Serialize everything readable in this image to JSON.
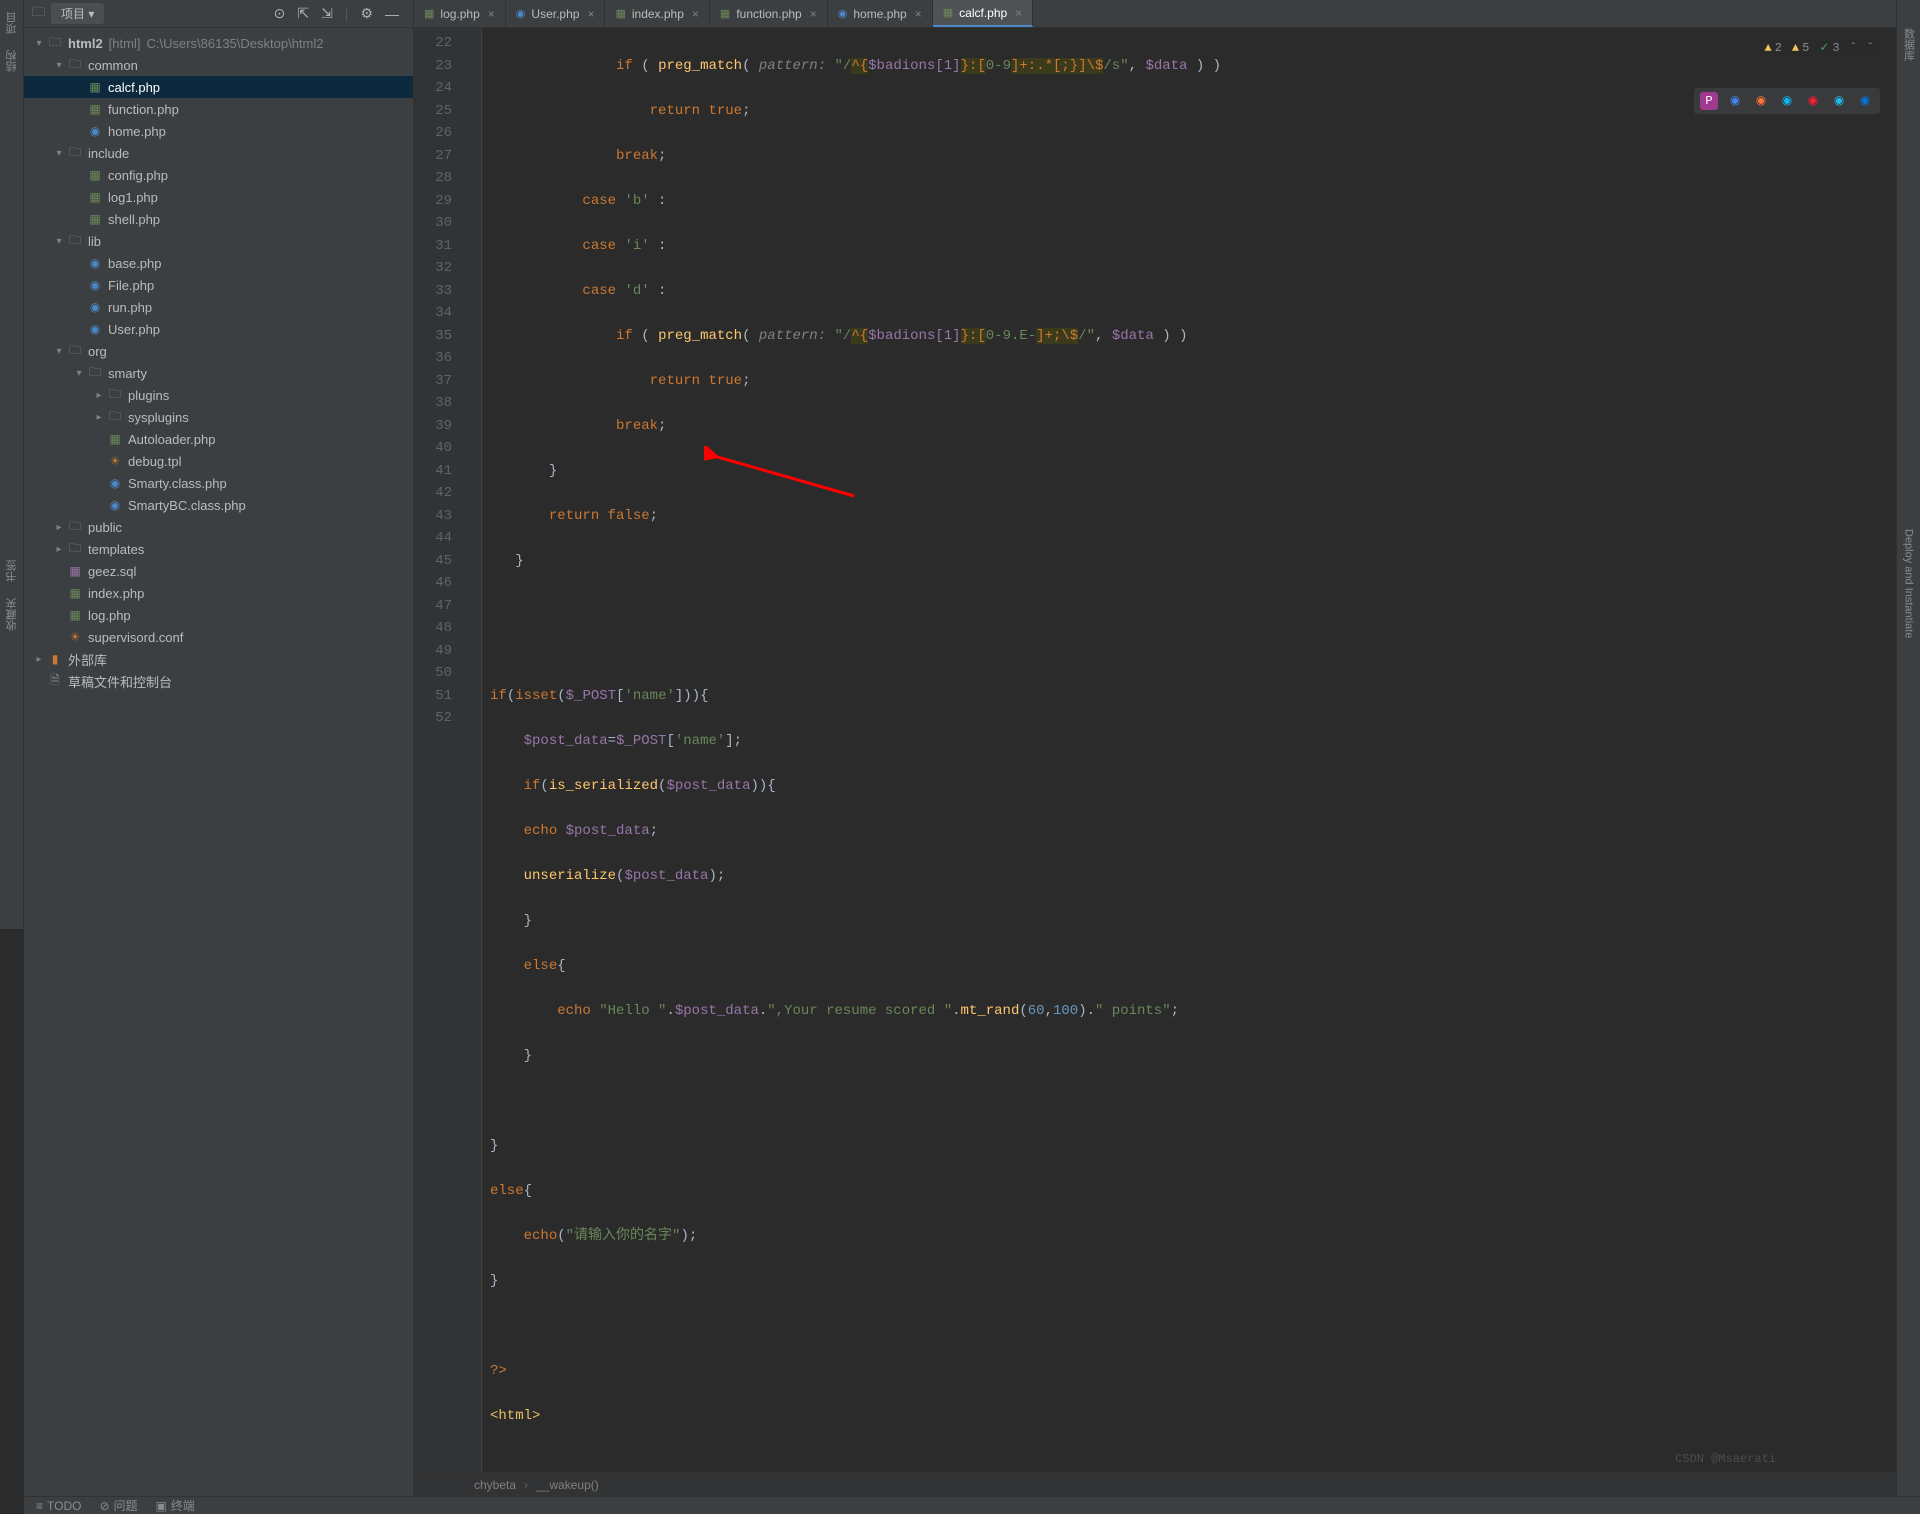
{
  "toolbar": {
    "project_label": "项目"
  },
  "left_strip": {
    "l1": "项目",
    "l2": "结构",
    "l3": "书签",
    "l4": "收藏夹"
  },
  "right_strip": {
    "l1": "数据库",
    "l2": "Deploy and Instantiate"
  },
  "tree": {
    "root": "html2",
    "root_hint_mod": "[html]",
    "root_hint_path": "C:\\Users\\86135\\Desktop\\html2",
    "common": "common",
    "calcf": "calcf.php",
    "function": "function.php",
    "home": "home.php",
    "include": "include",
    "config": "config.php",
    "log1": "log1.php",
    "shell": "shell.php",
    "lib": "lib",
    "base": "base.php",
    "file": "File.php",
    "run": "run.php",
    "user": "User.php",
    "org": "org",
    "smarty": "smarty",
    "plugins": "plugins",
    "sysplugins": "sysplugins",
    "autoloader": "Autoloader.php",
    "debug": "debug.tpl",
    "smartyc": "Smarty.class.php",
    "smartybc": "SmartyBC.class.php",
    "public": "public",
    "templates": "templates",
    "geez": "geez.sql",
    "indexphp": "index.php",
    "logphp": "log.php",
    "supervisord": "supervisord.conf",
    "ext_lib": "外部库",
    "scratch": "草稿文件和控制台"
  },
  "tabs": {
    "t1": "log.php",
    "t2": "User.php",
    "t3": "index.php",
    "t4": "function.php",
    "t5": "home.php",
    "t6": "calcf.php"
  },
  "gutter": {
    "start": 22,
    "end": 52
  },
  "inspections": {
    "warn": "2",
    "weak": "5",
    "typo": "3"
  },
  "breadcrumb": {
    "b1": "chybeta",
    "b2": "__wakeup()"
  },
  "bottom": {
    "todo": "TODO",
    "problems": "问题",
    "terminal": "终端"
  },
  "watermark": "CSDN @Msaerati",
  "code": {
    "l22_a": "if",
    "l22_b": " ( ",
    "l22_c": "preg_match",
    "l22_d": "( ",
    "l22_p": "pattern: ",
    "l22_r1": "\"/",
    "l22_r2": "^{",
    "l22_r3": "$badions[1]",
    "l22_r4": "}",
    "l22_r5": ":[",
    "l22_r6": "0-9",
    "l22_r7": "]+:.*[;}]\\$",
    "l22_r8": "/s\"",
    "l22_e": ", ",
    "l22_v": "$data",
    "l22_f": " ) )",
    "l23_a": "return ",
    "l23_b": "true",
    "l23_c": ";",
    "l24_a": "break",
    "l24_b": ";",
    "l25_a": "case ",
    "l25_b": "'b'",
    "l25_c": " :",
    "l26_a": "case ",
    "l26_b": "'i'",
    "l26_c": " :",
    "l27_a": "case ",
    "l27_b": "'d'",
    "l27_c": " :",
    "l28_a": "if",
    "l28_b": " ( ",
    "l28_c": "preg_match",
    "l28_d": "( ",
    "l28_p": "pattern: ",
    "l28_r1": "\"/",
    "l28_r2": "^{",
    "l28_r3": "$badions[1]",
    "l28_r4": "}",
    "l28_r5": ":[",
    "l28_r6": "0-9.E-",
    "l28_r7": "]+;\\$",
    "l28_r8": "/\"",
    "l28_e": ", ",
    "l28_v": "$data",
    "l28_f": " ) )",
    "l29_a": "return ",
    "l29_b": "true",
    "l29_c": ";",
    "l30_a": "break",
    "l30_b": ";",
    "l31_a": "}",
    "l32_a": "return ",
    "l32_b": "false",
    "l32_c": ";",
    "l33_a": "}",
    "l36_a": "if",
    "l36_b": "(",
    "l36_c": "isset",
    "l36_d": "(",
    "l36_v": "$_POST",
    "l36_e": "[",
    "l36_s": "'name'",
    "l36_f": "])){",
    "l37_v1": "$post_data",
    "l37_a": "=",
    "l37_v2": "$_POST",
    "l37_b": "[",
    "l37_s": "'name'",
    "l37_c": "];",
    "l38_a": "if",
    "l38_b": "(",
    "l38_c": "is_serialized",
    "l38_d": "(",
    "l38_v": "$post_data",
    "l38_e": ")){",
    "l39_a": "echo ",
    "l39_v": "$post_data",
    "l39_b": ";",
    "l40_a": "unserialize",
    "l40_b": "(",
    "l40_v": "$post_data",
    "l40_c": ");",
    "l41_a": "}",
    "l42_a": "else",
    "l42_b": "{",
    "l43_a": "echo ",
    "l43_s1": "\"Hello \"",
    "l43_b": ".",
    "l43_v": "$post_data",
    "l43_c": ".",
    "l43_s2": "\",Your resume scored \"",
    "l43_d": ".",
    "l43_fn": "mt_rand",
    "l43_e": "(",
    "l43_n1": "60",
    "l43_f": ",",
    "l43_n2": "100",
    "l43_g": ").",
    "l43_s3": "\" points\"",
    "l43_h": ";",
    "l44_a": "}",
    "l46_a": "}",
    "l47_a": "else",
    "l47_b": "{",
    "l48_a": "echo",
    "l48_b": "(",
    "l48_s": "\"请输入你的名字\"",
    "l48_c": ");",
    "l49_a": "}",
    "l51_a": "?>",
    "l52_a": "<",
    "l52_b": "html",
    "l52_c": ">"
  }
}
